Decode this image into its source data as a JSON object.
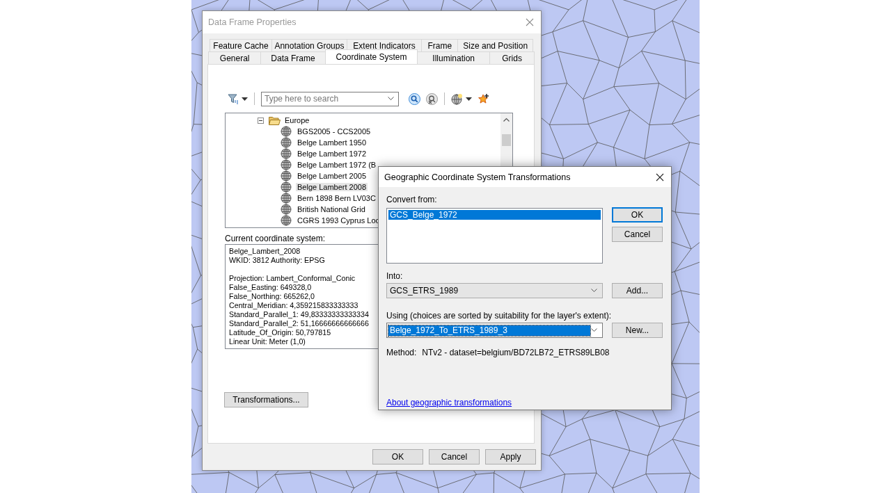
{
  "properties_dialog": {
    "title": "Data Frame Properties",
    "tab_rows": [
      {
        "tabs": [
          {
            "label": "Feature Cache",
            "selected": false
          },
          {
            "label": "Annotation Groups",
            "selected": false
          },
          {
            "label": "Extent Indicators",
            "selected": false
          },
          {
            "label": "Frame",
            "selected": false
          },
          {
            "label": "Size and Position",
            "selected": false
          }
        ]
      },
      {
        "tabs": [
          {
            "label": "General",
            "selected": false
          },
          {
            "label": "Data Frame",
            "selected": false
          },
          {
            "label": "Coordinate System",
            "selected": true
          },
          {
            "label": "Illumination",
            "selected": false
          },
          {
            "label": "Grids",
            "selected": false
          }
        ]
      }
    ],
    "search": {
      "placeholder": "Type here to search"
    },
    "tree": [
      {
        "label": "Europe",
        "expanded": true,
        "selected": false,
        "children": [
          {
            "label": "BGS2005 - CCS2005",
            "selected": false
          },
          {
            "label": "Belge Lambert 1950",
            "selected": false
          },
          {
            "label": "Belge Lambert 1972",
            "selected": false
          },
          {
            "label": "Belge Lambert 1972 (B",
            "selected": false
          },
          {
            "label": "Belge Lambert 2005",
            "selected": false
          },
          {
            "label": "Belge Lambert 2008",
            "selected": true
          },
          {
            "label": "Bern 1898 Bern LV03C",
            "selected": false
          },
          {
            "label": "British National Grid",
            "selected": false
          },
          {
            "label": "CGRS 1993 Cyprus Loc",
            "selected": false
          }
        ]
      }
    ],
    "current_label": "Current coordinate system:",
    "current_details": [
      [
        "Belge_Lambert_2008",
        "WKID: 3812 Authority: EPSG"
      ],
      [
        "Projection: Lambert_Conformal_Conic",
        "False_Easting: 649328,0",
        "False_Northing: 665262,0",
        "Central_Meridian: 4,359215833333333",
        "Standard_Parallel_1: 49,83333333333334",
        "Standard_Parallel_2: 51,16666666666666",
        "Latitude_Of_Origin: 50,797815",
        "Linear Unit: Meter (1,0)"
      ]
    ],
    "transformations_button": "Transformations...",
    "buttons": [
      "OK",
      "Cancel",
      "Apply"
    ]
  },
  "transform_dialog": {
    "title": "Geographic Coordinate System Transformations",
    "convert_from_label": "Convert from:",
    "convert_from": [
      {
        "text": "GCS_Belge_1972",
        "selected": true
      }
    ],
    "into_label": "Into:",
    "into_value": "GCS_ETRS_1989",
    "add_button": "Add...",
    "using_label": "Using (choices are sorted by suitability for the layer's extent):",
    "using_value": {
      "text": "Belge_1972_To_ETRS_1989_3",
      "selected": true
    },
    "new_button": "New...",
    "method_label": "Method:",
    "method_value": "NTv2 - dataset=belgium/BD72LB72_ETRS89LB08",
    "link": "About geographic transformations",
    "ok_button": "OK",
    "cancel_button": "Cancel"
  }
}
